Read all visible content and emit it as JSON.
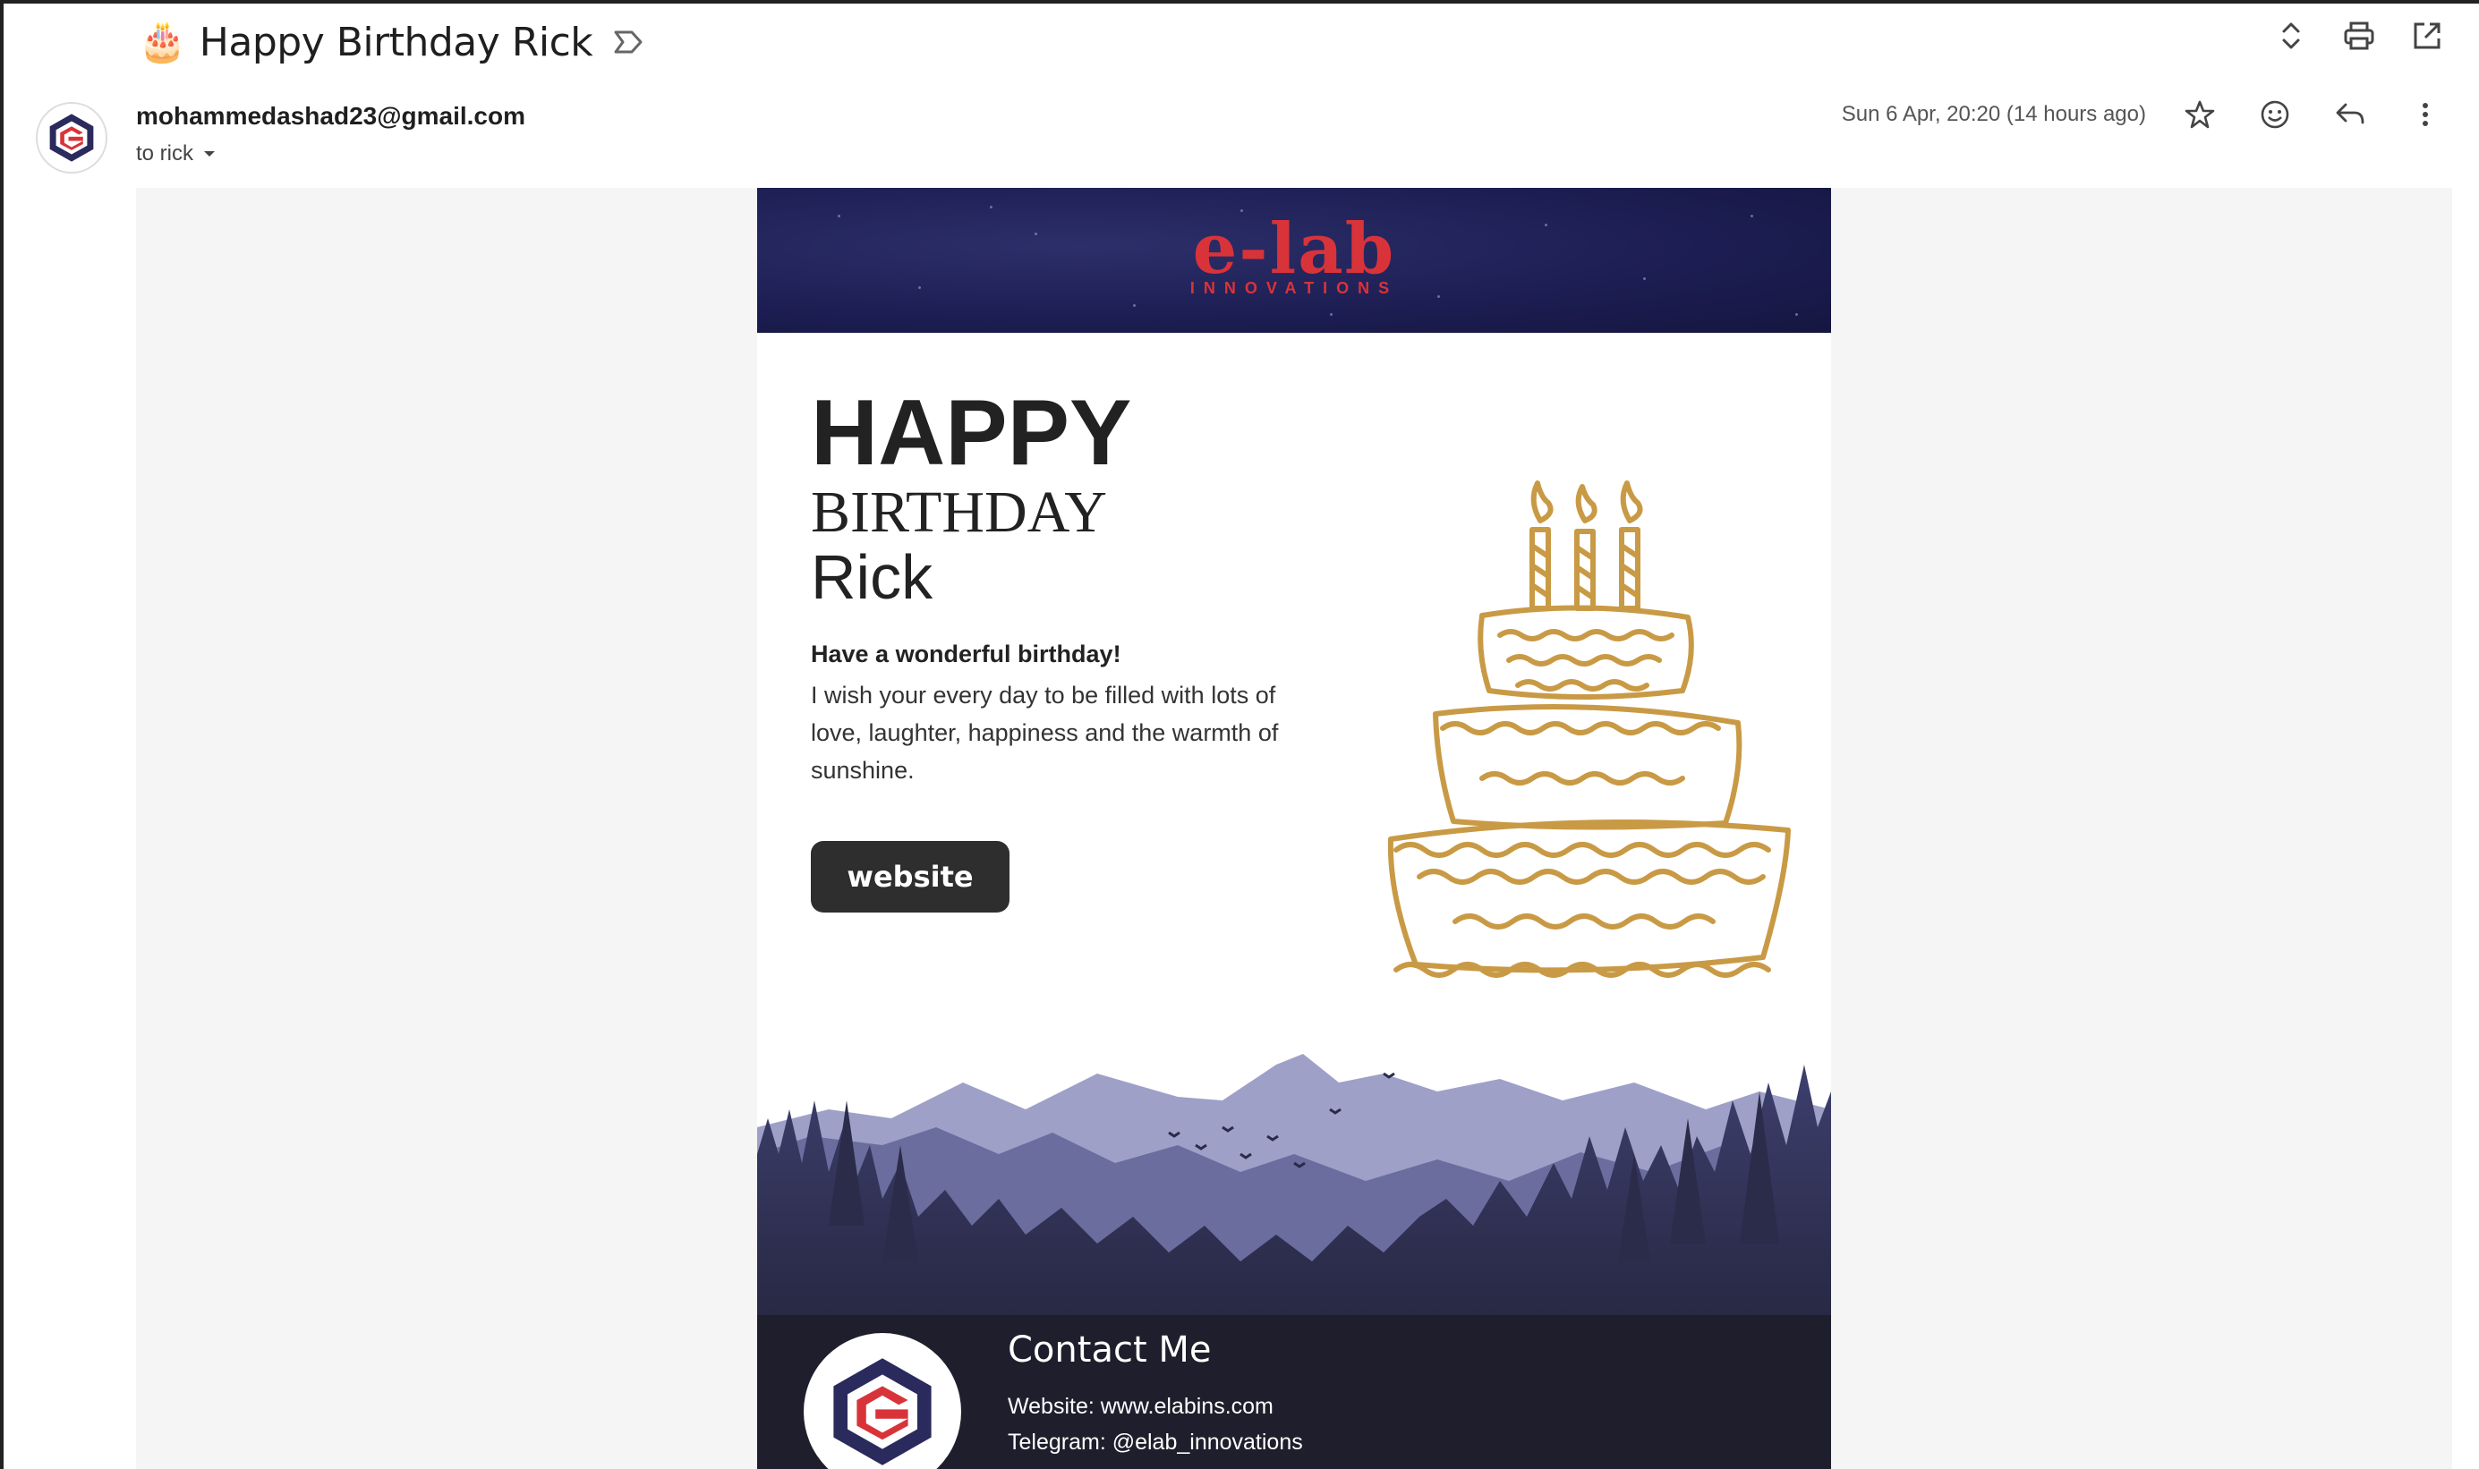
{
  "subject": {
    "emoji": "🎂",
    "title": "Happy Birthday Rick"
  },
  "sender": {
    "email": "mohammedashad23@gmail.com",
    "to": "to rick"
  },
  "meta": {
    "date": "Sun 6 Apr, 20:20 (14 hours ago)"
  },
  "icons": {
    "label": "label-icon",
    "expand": "expand-icon",
    "print": "print-icon",
    "open": "open-in-new-window-icon",
    "star": "star-icon",
    "emoji": "emoji-reaction-icon",
    "reply": "reply-icon",
    "more": "more-options-icon"
  },
  "email_body": {
    "brand_name": "e-lab",
    "brand_tag": "INNOVATIONS",
    "heading_1": "HAPPY",
    "heading_2": "BIRTHDAY",
    "heading_3": "Rick",
    "lead": "Have a wonderful birthday!",
    "wish": "I wish your every day to be filled with lots of love, laughter, happiness and the warmth of sunshine.",
    "button": "website",
    "contact_title": "Contact Me",
    "contact_website": "Website: www.elabins.com",
    "contact_telegram": "Telegram: @elab_innovations"
  },
  "colors": {
    "banner": "#1c1d52",
    "brand_red": "#d9333a",
    "cake_gold": "#c99a45",
    "button": "#2e2e2e",
    "footer": "#1e1e2c"
  }
}
